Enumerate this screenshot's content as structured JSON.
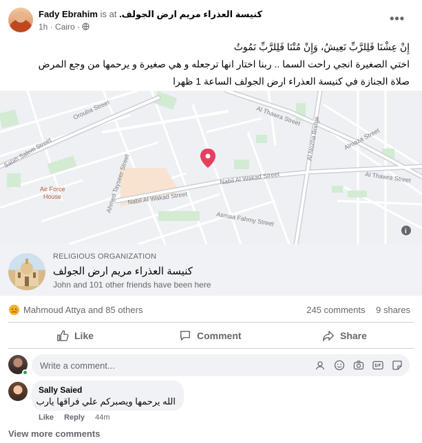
{
  "header": {
    "author": "Fady Ebrahim",
    "is_at": "is at",
    "place": "كنيسة العذراء مريم ارض الجولف.",
    "time": "1h",
    "separator": "·",
    "location": "Cairo",
    "separator2": "·",
    "more": "•••"
  },
  "post_text": {
    "line1": "إِنْ عِشْنَا فَلِلرَّبِّ نَعِيشُ، وَإِنْ مُتْنَا فَلِلرَّبِّ نَمُوتُ",
    "line2": "اختي الصغيرة انجي راحت السما .. ربنا اختار انها ترجعله و هي صغيرة و يرحمها من وجع المرض",
    "line3": "صلاة الجنازة في كنيسة العذراء ارض الجولف  الساعة 1 ظهرا"
  },
  "map": {
    "streets": [
      "Orouba Street",
      "Salah Salem Street",
      "Al Thawra Street",
      "Almaza Street",
      "Al Thawra Street",
      "Al Nozha Bridge",
      "Nabil Al Wakad Street",
      "Nabil Al Wakad Street",
      "Ahmed Tayseer Street",
      "Asmaa Fahmy Street"
    ],
    "poi": [
      "Air Force",
      "House"
    ],
    "pin_color": "#e4405f",
    "info_icon": "i"
  },
  "place": {
    "type": "RELIGIOUS ORGANIZATION",
    "name": "كنيسة العذراء مريم ارض الجولف",
    "visitors": "John and 101 other friends have been here"
  },
  "reactions": {
    "names": "Mahmoud Attya and 85 others",
    "comments": "245 comments",
    "shares": "9 shares",
    "emoji": "sad-reaction-icon"
  },
  "actions": {
    "like": "Like",
    "comment": "Comment",
    "share": "Share"
  },
  "comment_box": {
    "placeholder": "Write a comment..."
  },
  "comments": [
    {
      "author": "Sally Saied",
      "text": "الله يرحمها ويصبركم علي فراقها يارب",
      "like": "Like",
      "reply": "Reply",
      "time": "44m"
    }
  ],
  "view_more": "View more comments"
}
